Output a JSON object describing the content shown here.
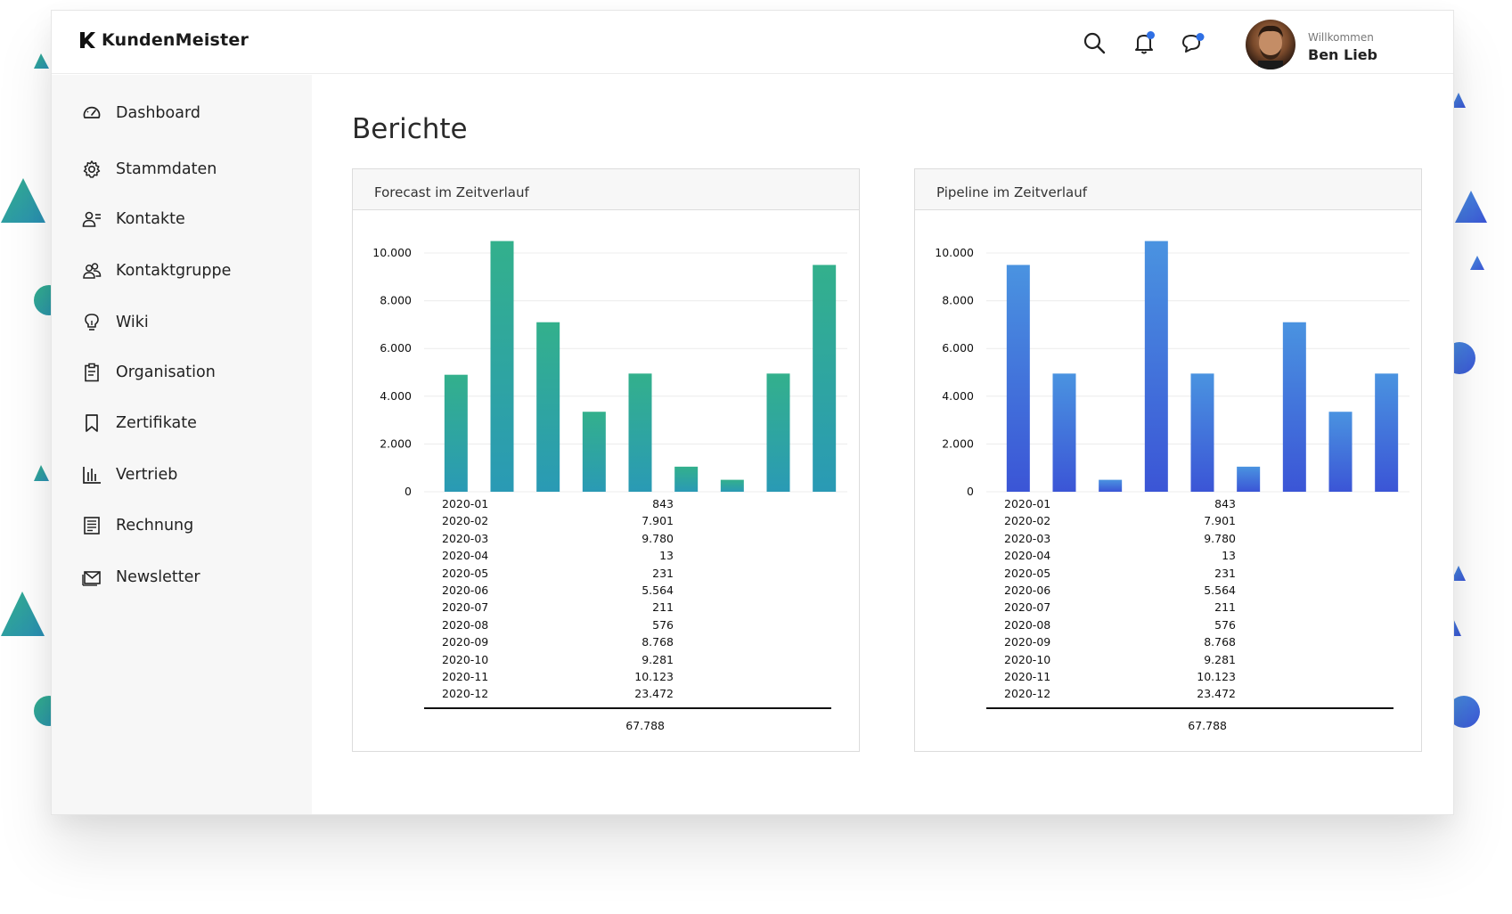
{
  "app": {
    "logo_text": "KundenMeister"
  },
  "header": {
    "welcome_label": "Willkommen",
    "user_name": "Ben Lieb",
    "icons": [
      "search-icon",
      "bell-icon",
      "chat-icon"
    ],
    "notification_dot_color": "#2f6fe4"
  },
  "sidebar": {
    "items": [
      {
        "label": "Dashboard",
        "icon": "gauge-icon"
      },
      {
        "label": "Stammdaten",
        "icon": "gear-icon"
      },
      {
        "label": "Kontakte",
        "icon": "contact-icon"
      },
      {
        "label": "Kontaktgruppe",
        "icon": "group-icon"
      },
      {
        "label": "Wiki",
        "icon": "lightbulb-icon"
      },
      {
        "label": "Organisation",
        "icon": "clipboard-icon"
      },
      {
        "label": "Zertifikate",
        "icon": "bookmark-icon"
      },
      {
        "label": "Vertrieb",
        "icon": "bar-chart-icon"
      },
      {
        "label": "Rechnung",
        "icon": "invoice-icon"
      },
      {
        "label": "Newsletter",
        "icon": "mail-icon"
      }
    ]
  },
  "main": {
    "page_title": "Berichte"
  },
  "colors": {
    "green_top": "#33b08c",
    "green_bottom": "#2a9ab5",
    "blue_top": "#4a93e0",
    "blue_bottom": "#3b55d6"
  },
  "chart_data": [
    {
      "type": "bar",
      "title": "Forecast im Zeitverlauf",
      "ylim": [
        0,
        10000
      ],
      "yticks": [
        "0",
        "2.000",
        "4.000",
        "6.000",
        "8.000",
        "10.000"
      ],
      "values": [
        4900,
        10500,
        7100,
        3350,
        4950,
        1050,
        500,
        4950,
        9500
      ],
      "table": {
        "rows": [
          {
            "month": "2020-01",
            "value": "843"
          },
          {
            "month": "2020-02",
            "value": "7.901"
          },
          {
            "month": "2020-03",
            "value": "9.780"
          },
          {
            "month": "2020-04",
            "value": "13"
          },
          {
            "month": "2020-05",
            "value": "231"
          },
          {
            "month": "2020-06",
            "value": "5.564"
          },
          {
            "month": "2020-07",
            "value": "211"
          },
          {
            "month": "2020-08",
            "value": "576"
          },
          {
            "month": "2020-09",
            "value": "8.768"
          },
          {
            "month": "2020-10",
            "value": "9.281"
          },
          {
            "month": "2020-11",
            "value": "10.123"
          },
          {
            "month": "2020-12",
            "value": "23.472"
          }
        ],
        "total": "67.788"
      }
    },
    {
      "type": "bar",
      "title": "Pipeline im Zeitverlauf",
      "ylim": [
        0,
        10000
      ],
      "yticks": [
        "0",
        "2.000",
        "4.000",
        "6.000",
        "8.000",
        "10.000"
      ],
      "values": [
        9500,
        4950,
        500,
        10500,
        4950,
        1050,
        7100,
        3350,
        4950
      ],
      "table": {
        "rows": [
          {
            "month": "2020-01",
            "value": "843"
          },
          {
            "month": "2020-02",
            "value": "7.901"
          },
          {
            "month": "2020-03",
            "value": "9.780"
          },
          {
            "month": "2020-04",
            "value": "13"
          },
          {
            "month": "2020-05",
            "value": "231"
          },
          {
            "month": "2020-06",
            "value": "5.564"
          },
          {
            "month": "2020-07",
            "value": "211"
          },
          {
            "month": "2020-08",
            "value": "576"
          },
          {
            "month": "2020-09",
            "value": "8.768"
          },
          {
            "month": "2020-10",
            "value": "9.281"
          },
          {
            "month": "2020-11",
            "value": "10.123"
          },
          {
            "month": "2020-12",
            "value": "23.472"
          }
        ],
        "total": "67.788"
      }
    }
  ]
}
